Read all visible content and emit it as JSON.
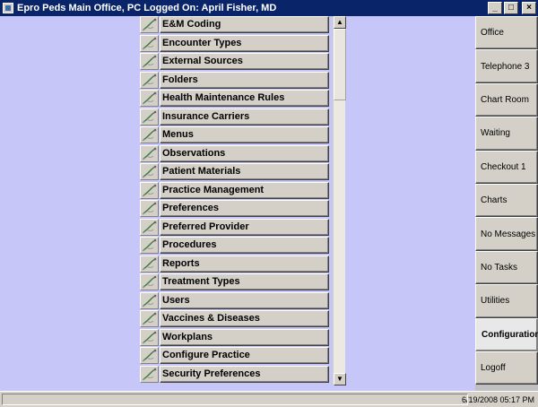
{
  "window": {
    "title": "Epro Peds Main Office, PC  Logged On:  April Fisher, MD",
    "minimize": "_",
    "restore": "□",
    "close": "×"
  },
  "config_items": [
    {
      "label": "E&M Coding"
    },
    {
      "label": "Encounter Types"
    },
    {
      "label": "External Sources"
    },
    {
      "label": "Folders"
    },
    {
      "label": "Health Maintenance Rules"
    },
    {
      "label": "Insurance Carriers"
    },
    {
      "label": "Menus"
    },
    {
      "label": "Observations"
    },
    {
      "label": "Patient Materials"
    },
    {
      "label": "Practice Management"
    },
    {
      "label": "Preferences"
    },
    {
      "label": "Preferred Provider"
    },
    {
      "label": "Procedures"
    },
    {
      "label": "Reports"
    },
    {
      "label": "Treatment Types"
    },
    {
      "label": "Users"
    },
    {
      "label": "Vaccines & Diseases"
    },
    {
      "label": "Workplans"
    },
    {
      "label": "Configure Practice"
    },
    {
      "label": "Security Preferences"
    }
  ],
  "scrollbar": {
    "up": "▲",
    "down": "▼"
  },
  "nav": [
    {
      "label": "Office",
      "active": false
    },
    {
      "label": "Telephone 3",
      "active": false
    },
    {
      "label": "Chart Room",
      "active": false
    },
    {
      "label": "Waiting",
      "active": false
    },
    {
      "label": "Checkout 1",
      "active": false
    },
    {
      "label": "Charts",
      "active": false
    },
    {
      "label": "No Messages",
      "active": false
    },
    {
      "label": "No Tasks",
      "active": false
    },
    {
      "label": "Utilities",
      "active": false
    },
    {
      "label": "Configuration",
      "active": true
    },
    {
      "label": "Logoff",
      "active": false
    }
  ],
  "status": {
    "datetime": "6/19/2008  05:17 PM"
  },
  "icons": {
    "item": "stethoscope-icon",
    "app": "app-icon"
  }
}
